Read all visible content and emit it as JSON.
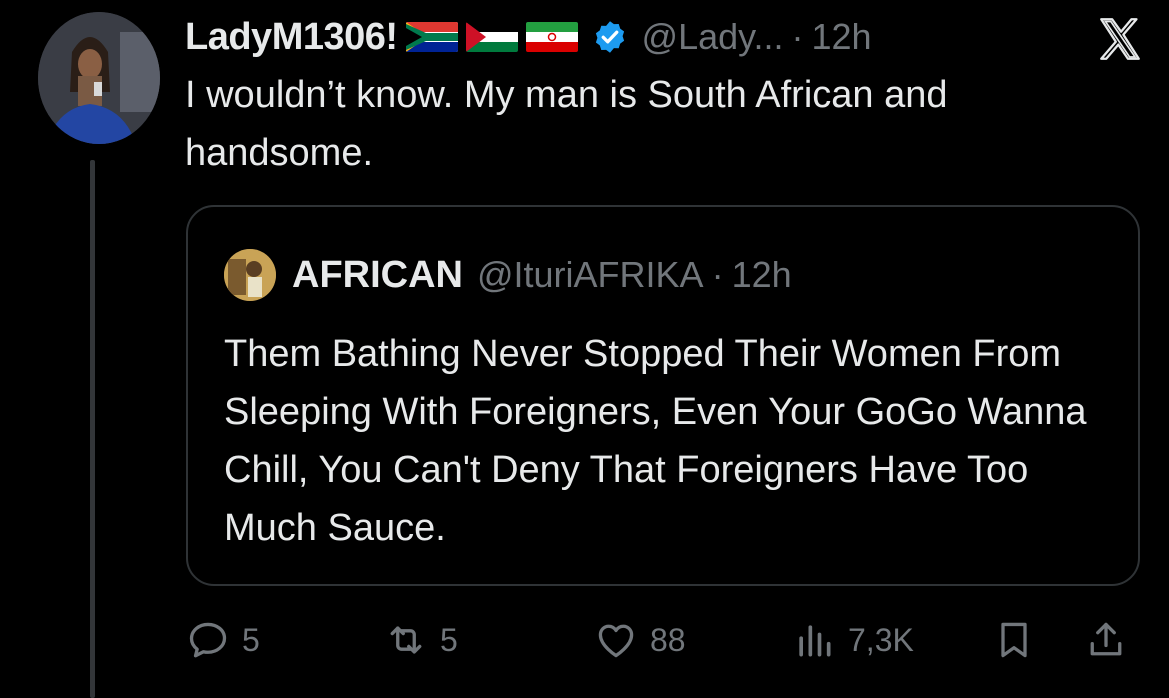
{
  "post": {
    "display_name": "LadyM1306!",
    "handle": "@Lady...",
    "dot": "·",
    "time": "12h",
    "text": "I wouldn’t know. My man is South African and handsome."
  },
  "quote": {
    "display_name": "AFRICAN",
    "handle": "@IturiAFRIKA",
    "dot": "·",
    "time": "12h",
    "text": "Them Bathing Never Stopped Their Women From Sleeping With Foreigners, Even Your GoGo Wanna Chill, You Can't Deny That Foreigners Have Too Much Sauce."
  },
  "actions": {
    "replies": "5",
    "reposts": "5",
    "likes": "88",
    "views": "7,3K"
  },
  "icons": {
    "flags": [
      "south-africa-flag",
      "palestine-flag",
      "iran-flag"
    ],
    "verified": "verified-badge-icon",
    "logo": "x-logo-icon",
    "action_icons": [
      "reply-icon",
      "repost-icon",
      "like-icon",
      "views-icon",
      "bookmark-icon",
      "share-icon"
    ]
  },
  "colors": {
    "background": "#000000",
    "text": "#e7e9ea",
    "secondary": "#71767b",
    "border": "#2f3336",
    "verified": "#1d9bf0"
  }
}
